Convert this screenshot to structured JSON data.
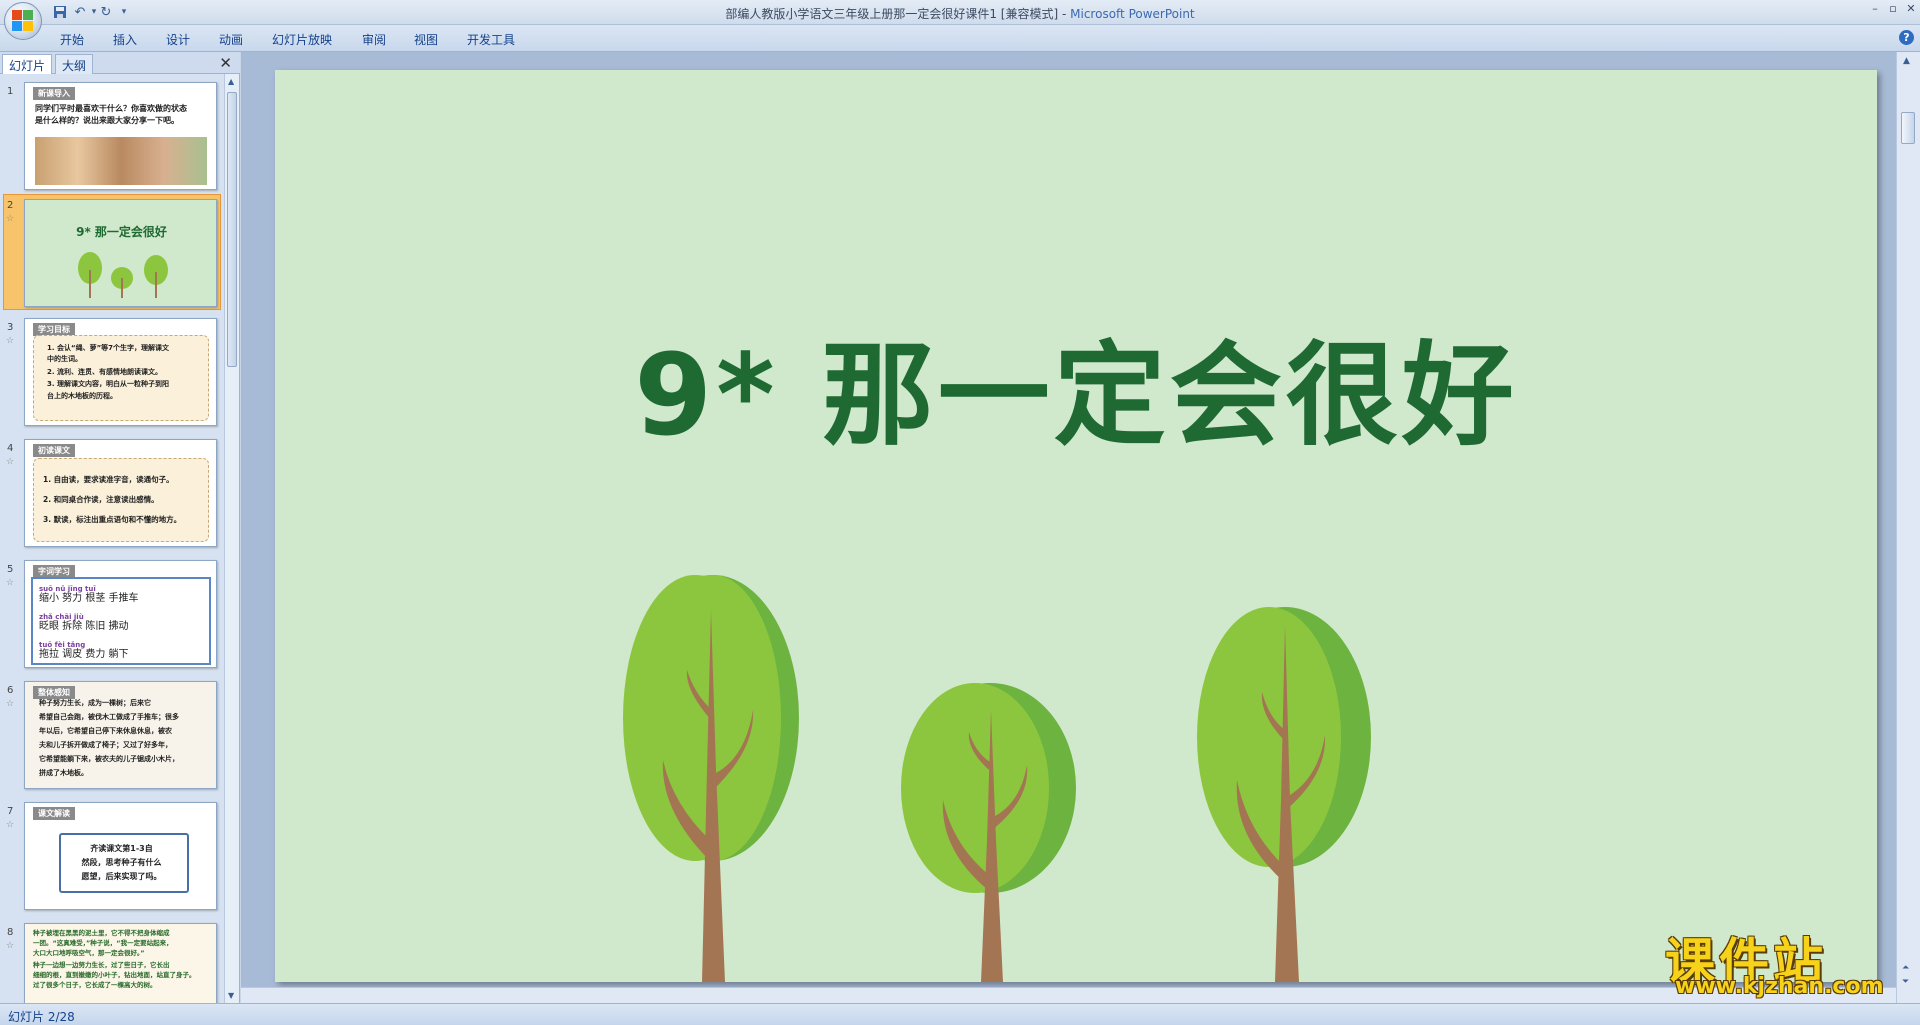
{
  "window": {
    "title_doc": "部编人教版小学语文三年级上册那一定会很好课件1 [兼容模式] - ",
    "title_app": "Microsoft PowerPoint"
  },
  "ribbon": {
    "tabs": [
      "开始",
      "插入",
      "设计",
      "动画",
      "幻灯片放映",
      "审阅",
      "视图",
      "开发工具"
    ]
  },
  "left_pane": {
    "tab_slides": "幻灯片",
    "tab_outline": "大纲",
    "thumbnails": [
      {
        "num": "1",
        "tag": "新课导入",
        "lines": [
          "同学们平时最喜欢干什么？你喜欢做的状态",
          "是什么样的？说出来跟大家分享一下吧。"
        ]
      },
      {
        "num": "2",
        "title": "9* 那一定会很好"
      },
      {
        "num": "3",
        "tag": "学习目标",
        "lines": [
          "1. 会认“绳、萝”等7个生字，理解课文",
          "中的生词。",
          "2. 流利、连贯、有感情地朗读课文。",
          "3. 理解课文内容，明白从一粒种子到阳",
          "台上的木地板的历程。"
        ]
      },
      {
        "num": "4",
        "tag": "初读课文",
        "lines": [
          "1. 自由读，要求读准字音，读通句子。",
          "2. 和同桌合作读，注意读出感情。",
          "3. 默读，标注出重点语句和不懂的地方。"
        ]
      },
      {
        "num": "5",
        "tag": "字词学习",
        "lines": [
          "suō nǔ jīng tuī",
          "缩小 努力 根茎 手推车",
          "zhǎ chāi jiù",
          "眨眼 拆除 陈旧 拂动",
          "tuō fèi tǎng",
          "拖拉 调皮 费力 躺下"
        ]
      },
      {
        "num": "6",
        "tag": "整体感知",
        "lines": [
          "种子努力生长，成为一棵树；后来它",
          "希望自己会跑，被伐木工做成了手推车；很多",
          "年以后，它希望自己停下来休息休息，被农",
          "夫和儿子拆开做成了椅子；又过了好多年，",
          "它希望能躺下来，被农夫的儿子锯成小木片，",
          "拼成了木地板。"
        ]
      },
      {
        "num": "7",
        "tag": "课文解读",
        "lines": [
          "齐读课文第1-3自",
          "然段，思考种子有什么",
          "愿望，后来实现了吗。"
        ]
      },
      {
        "num": "8",
        "lines": [
          "种子被埋在黑黑的泥土里，它不得不把身体缩成",
          "一团。“这真难受，”种子说，“我一定要站起来，",
          "大口大口地呼吸空气，那一定会很好。”",
          "种子一边想一边努力生长，过了些日子，它长出",
          "细细的根，直到嫩嫩的小叶子，钻出地面，站直了身子。",
          "过了很多个日子，它长成了一棵高大的树。"
        ]
      }
    ]
  },
  "slide": {
    "title": "9*  那一定会很好"
  },
  "watermark": {
    "text": "课件站",
    "url": "www.kjzhan.com"
  },
  "status": {
    "text": "幻灯片 2/28"
  },
  "colors": {
    "slide_bg": "#d0e8cb",
    "title_green": "#1f6a33",
    "tree_light": "#8cc63f",
    "tree_dark": "#6db33f",
    "trunk": "#a47552",
    "selection": "#f7c46b"
  }
}
